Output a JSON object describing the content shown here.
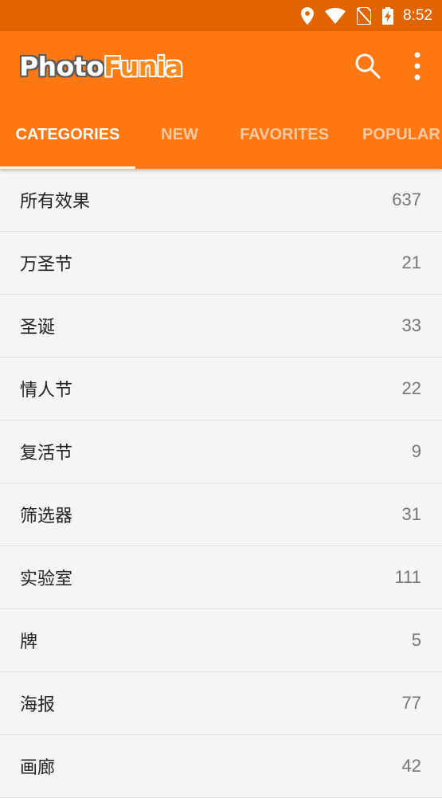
{
  "status_bar": {
    "time": "8:52",
    "icons": [
      "location-icon",
      "wifi-icon",
      "no-sim-icon",
      "battery-charging-icon"
    ]
  },
  "app": {
    "logo_part1": "Photo",
    "logo_part2": "Funia",
    "actions": [
      "search-icon",
      "overflow-menu-icon"
    ]
  },
  "tabs": [
    {
      "label": "CATEGORIES",
      "active": true
    },
    {
      "label": "NEW",
      "active": false
    },
    {
      "label": "FAVORITES",
      "active": false
    },
    {
      "label": "POPULAR",
      "active": false
    }
  ],
  "categories": [
    {
      "name": "所有效果",
      "count": "637"
    },
    {
      "name": "万圣节",
      "count": "21"
    },
    {
      "name": "圣诞",
      "count": "33"
    },
    {
      "name": "情人节",
      "count": "22"
    },
    {
      "name": "复活节",
      "count": "9"
    },
    {
      "name": "筛选器",
      "count": "31"
    },
    {
      "name": "实验室",
      "count": "111"
    },
    {
      "name": "牌",
      "count": "5"
    },
    {
      "name": "海报",
      "count": "77"
    },
    {
      "name": "画廊",
      "count": "42"
    }
  ],
  "colors": {
    "status_bar": "#e06500",
    "app_bar": "#ff7814",
    "list_background": "#f5f5f5",
    "divider": "#dedede"
  }
}
